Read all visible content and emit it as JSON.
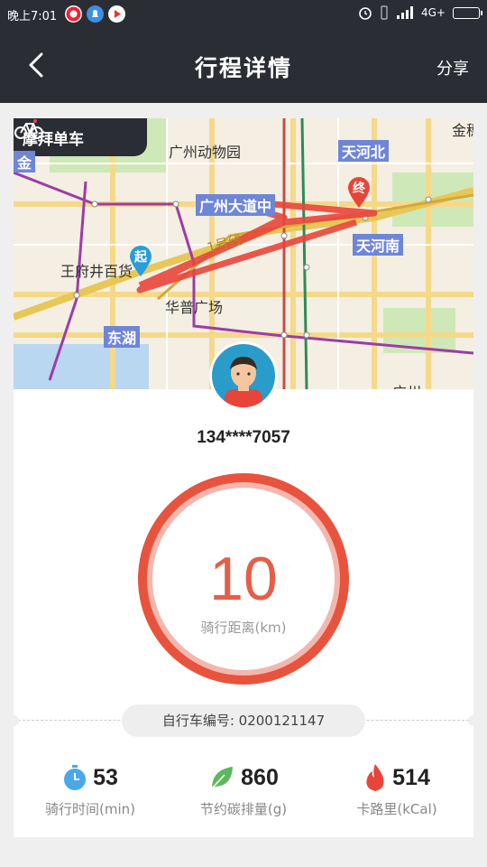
{
  "status_bar": {
    "time": "晚上7:01",
    "network": "4G+"
  },
  "header": {
    "title": "行程详情",
    "share_label": "分享"
  },
  "map": {
    "brand": "摩拜单车",
    "labels": {
      "zoo": "广州动物园",
      "tianhebei": "天河北",
      "guangzhou_dadao": "广州大道中",
      "tianhenan": "天河南",
      "wangfujing": "王府井百货",
      "huapu": "华普广场",
      "donghu": "东湖",
      "line1": "1号线",
      "jin": "金",
      "jinhui": "金穗",
      "guangzhou_bottom": "广州"
    },
    "start_pin": "起",
    "end_pin": "终"
  },
  "user": {
    "phone": "134****7057"
  },
  "ride": {
    "distance": "10",
    "distance_label": "骑行距离(km)"
  },
  "bike": {
    "number_label": "自行车编号: 0200121147"
  },
  "stats": [
    {
      "icon": "stopwatch-icon",
      "value": "53",
      "label": "骑行时间(min)"
    },
    {
      "icon": "leaf-icon",
      "value": "860",
      "label": "节约碳排量(g)"
    },
    {
      "icon": "flame-icon",
      "value": "514",
      "label": "卡路里(kCal)"
    }
  ],
  "colors": {
    "header_bg": "#2b2d34",
    "accent": "#e8533d",
    "route": "#e8453a"
  }
}
